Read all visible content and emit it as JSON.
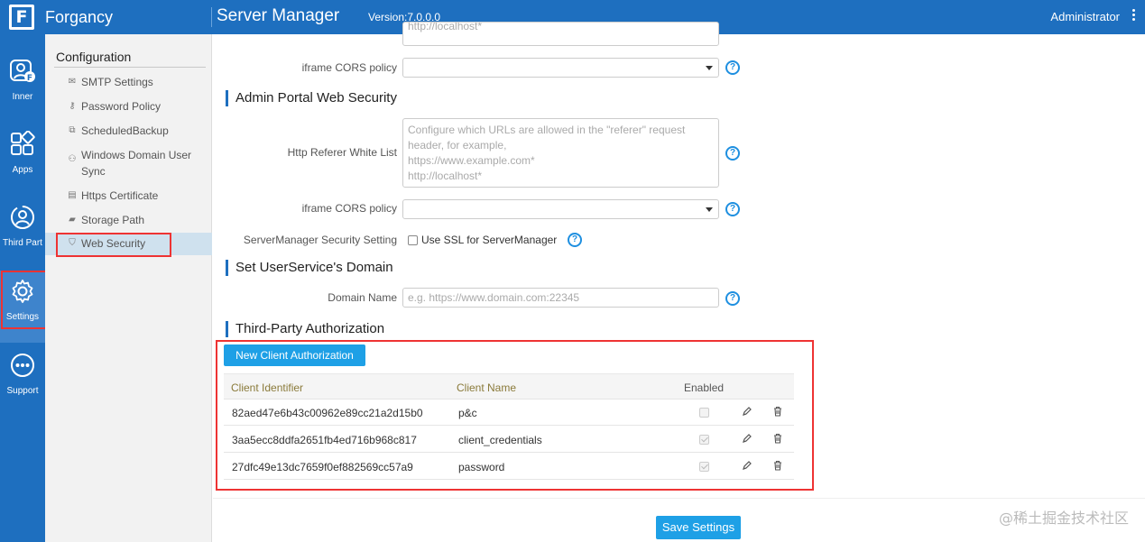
{
  "header": {
    "brand": "Forgancy",
    "logo_letter": "F",
    "app_title": "Server Manager",
    "version": "Version:7.0.0.0",
    "user": "Administrator"
  },
  "rail": [
    {
      "label": "Inner",
      "icon": "user-badge-icon"
    },
    {
      "label": "Apps",
      "icon": "apps-grid-icon"
    },
    {
      "label": "Third Part",
      "icon": "third-party-icon"
    },
    {
      "label": "Settings",
      "icon": "gear-icon"
    },
    {
      "label": "Support",
      "icon": "more-dots-icon"
    }
  ],
  "sidenav": {
    "title": "Configuration",
    "items": [
      {
        "label": "SMTP Settings",
        "icon": "mail-icon"
      },
      {
        "label": "Password Policy",
        "icon": "key-icon"
      },
      {
        "label": "ScheduledBackup",
        "icon": "backup-icon"
      },
      {
        "label": "Windows Domain User Sync",
        "icon": "sync-users-icon"
      },
      {
        "label": "Https Certificate",
        "icon": "certificate-icon"
      },
      {
        "label": "Storage Path",
        "icon": "folder-icon"
      },
      {
        "label": "Web Security",
        "icon": "shield-icon"
      }
    ]
  },
  "main": {
    "top_textarea_tail": "http://localhost*",
    "iframe_cors_label": "iframe CORS policy",
    "admin_portal": {
      "heading": "Admin Portal Web Security",
      "referer_label": "Http Referer White List",
      "referer_placeholder": "Configure which URLs are allowed in the \"referer\" request header, for example,\nhttps://www.example.com*\nhttp://localhost*",
      "iframe_cors_label": "iframe CORS policy",
      "sm_security_label": "ServerManager Security Setting",
      "use_ssl_label": "Use SSL for ServerManager"
    },
    "user_service": {
      "heading": "Set UserService's Domain",
      "domain_label": "Domain Name",
      "domain_placeholder": "e.g. https://www.domain.com:22345"
    },
    "third_party": {
      "heading": "Third-Party Authorization",
      "new_button": "New Client Authorization",
      "columns": [
        "Client Identifier",
        "Client Name",
        "Enabled"
      ],
      "rows": [
        {
          "id": "82aed47e6b43c00962e89cc21a2d15b0",
          "name": "p&c",
          "enabled": false
        },
        {
          "id": "3aa5ecc8ddfa2651fb4ed716b968c817",
          "name": "client_credentials",
          "enabled": true
        },
        {
          "id": "27dfc49e13dc7659f0ef882569cc57a9",
          "name": "password",
          "enabled": true
        }
      ]
    },
    "save_button": "Save Settings"
  },
  "watermark": "@稀土掘金技术社区",
  "colors": {
    "brand_blue": "#1e6fbf",
    "button_blue": "#1ea0e6",
    "highlight_red": "#e33"
  }
}
